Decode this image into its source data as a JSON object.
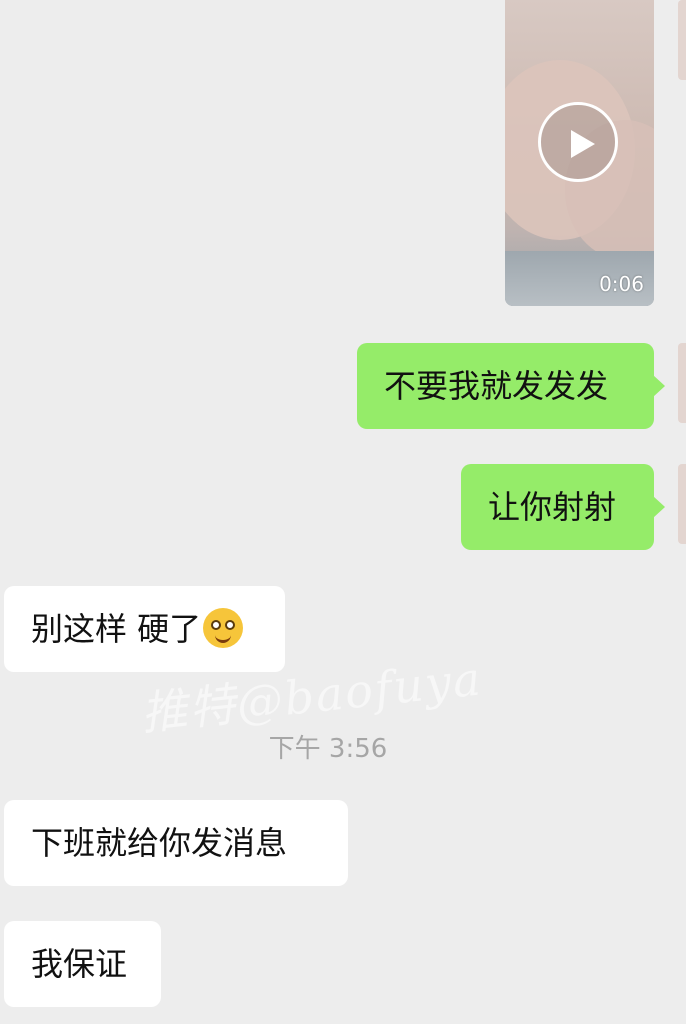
{
  "video_message": {
    "duration": "0:06",
    "play_icon": "play-icon"
  },
  "messages": [
    {
      "id": "m1",
      "sender": "me",
      "text": "不要我就发发发"
    },
    {
      "id": "m2",
      "sender": "me",
      "text": "让你射射"
    },
    {
      "id": "m3",
      "sender": "them",
      "text": "别这样 硬了",
      "emoji": "drooling-face-icon"
    },
    {
      "id": "m4",
      "sender": "them",
      "text": "下班就给你发消息"
    },
    {
      "id": "m5",
      "sender": "them",
      "text": "我保证"
    }
  ],
  "timestamp": "下午 3:56",
  "watermark": "推特@baofuya",
  "colors": {
    "background": "#ededed",
    "outgoing_bubble": "#95ec69",
    "incoming_bubble": "#ffffff",
    "timestamp_text": "#a6a6a6"
  }
}
